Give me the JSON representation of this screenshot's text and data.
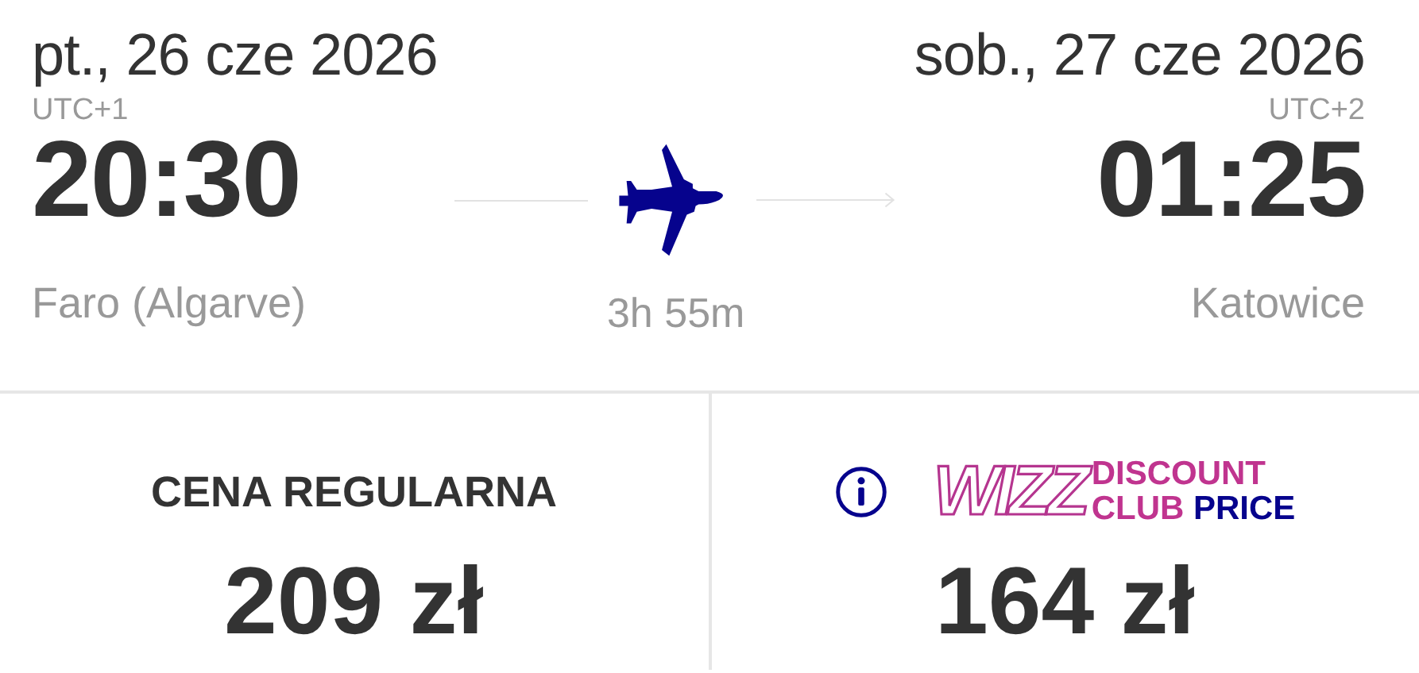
{
  "departure": {
    "date": "pt., 26 cze 2026",
    "timezone": "UTC+1",
    "time": "20:30",
    "city": "Faro (Algarve)"
  },
  "duration": "3h 55m",
  "arrival": {
    "date": "sob., 27 cze 2026",
    "timezone": "UTC+2",
    "time": "01:25",
    "city": "Katowice"
  },
  "fares": [
    {
      "kind": "regular",
      "label": "CENA REGULARNA",
      "price": "209 zł"
    },
    {
      "kind": "club",
      "logo": {
        "brand": "WIZZ",
        "line1": "DISCOUNT",
        "line2_a": "CLUB",
        "line2_b": "PRICE"
      },
      "price": "164 zł"
    }
  ]
}
